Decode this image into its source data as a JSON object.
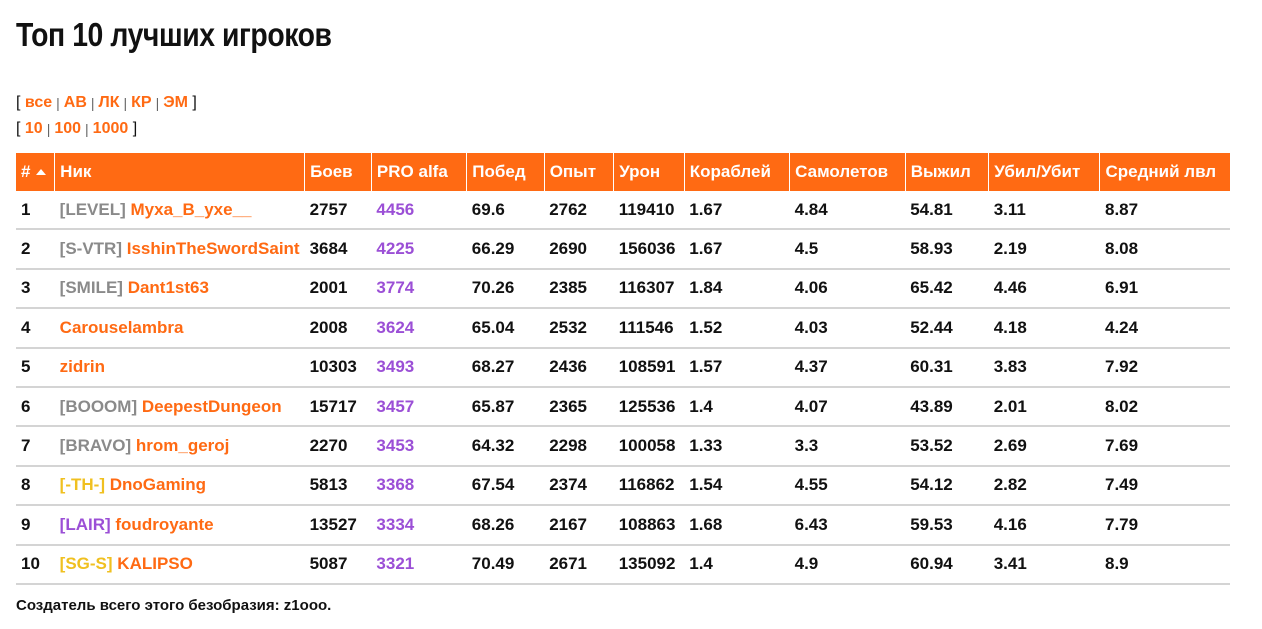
{
  "page": {
    "title": "Топ 10 лучших игроков",
    "footer": "Создатель всего этого безобразия: z1ooo."
  },
  "filters": {
    "types": [
      "все",
      "АВ",
      "ЛК",
      "КР",
      "ЭМ"
    ],
    "counts": [
      "10",
      "100",
      "1000"
    ]
  },
  "table": {
    "headers": [
      "#",
      "Ник",
      "Боев",
      "PRO alfa",
      "Побед",
      "Опыт",
      "Урон",
      "Кораблей",
      "Самолетов",
      "Выжил",
      "Убил/Убит",
      "Средний лвл"
    ],
    "rows": [
      {
        "rank": "1",
        "clan": "[LEVEL]",
        "clan_color": "gray",
        "nick": "Myxa_B_yxe__",
        "battles": "2757",
        "pro": "4456",
        "wins": "69.6",
        "exp": "2762",
        "damage": "119410",
        "ships": "1.67",
        "planes": "4.84",
        "survived": "54.81",
        "kd": "3.11",
        "avg_lvl": "8.87"
      },
      {
        "rank": "2",
        "clan": "[S-VTR]",
        "clan_color": "gray",
        "nick": "IsshinTheSwordSaint",
        "battles": "3684",
        "pro": "4225",
        "wins": "66.29",
        "exp": "2690",
        "damage": "156036",
        "ships": "1.67",
        "planes": "4.5",
        "survived": "58.93",
        "kd": "2.19",
        "avg_lvl": "8.08"
      },
      {
        "rank": "3",
        "clan": "[SMILE]",
        "clan_color": "gray",
        "nick": "Dant1st63",
        "battles": "2001",
        "pro": "3774",
        "wins": "70.26",
        "exp": "2385",
        "damage": "116307",
        "ships": "1.84",
        "planes": "4.06",
        "survived": "65.42",
        "kd": "4.46",
        "avg_lvl": "6.91"
      },
      {
        "rank": "4",
        "clan": "",
        "clan_color": "gray",
        "nick": "Carouselambra",
        "battles": "2008",
        "pro": "3624",
        "wins": "65.04",
        "exp": "2532",
        "damage": "111546",
        "ships": "1.52",
        "planes": "4.03",
        "survived": "52.44",
        "kd": "4.18",
        "avg_lvl": "4.24"
      },
      {
        "rank": "5",
        "clan": "",
        "clan_color": "gray",
        "nick": "zidrin",
        "battles": "10303",
        "pro": "3493",
        "wins": "68.27",
        "exp": "2436",
        "damage": "108591",
        "ships": "1.57",
        "planes": "4.37",
        "survived": "60.31",
        "kd": "3.83",
        "avg_lvl": "7.92"
      },
      {
        "rank": "6",
        "clan": "[BOOOM]",
        "clan_color": "gray",
        "nick": "DeepestDungeon",
        "battles": "15717",
        "pro": "3457",
        "wins": "65.87",
        "exp": "2365",
        "damage": "125536",
        "ships": "1.4",
        "planes": "4.07",
        "survived": "43.89",
        "kd": "2.01",
        "avg_lvl": "8.02"
      },
      {
        "rank": "7",
        "clan": "[BRAVO]",
        "clan_color": "gray",
        "nick": "hrom_geroj",
        "battles": "2270",
        "pro": "3453",
        "wins": "64.32",
        "exp": "2298",
        "damage": "100058",
        "ships": "1.33",
        "planes": "3.3",
        "survived": "53.52",
        "kd": "2.69",
        "avg_lvl": "7.69"
      },
      {
        "rank": "8",
        "clan": "[-TH-]",
        "clan_color": "yellow",
        "nick": "DnoGaming",
        "battles": "5813",
        "pro": "3368",
        "wins": "67.54",
        "exp": "2374",
        "damage": "116862",
        "ships": "1.54",
        "planes": "4.55",
        "survived": "54.12",
        "kd": "2.82",
        "avg_lvl": "7.49"
      },
      {
        "rank": "9",
        "clan": "[LAIR]",
        "clan_color": "purple",
        "nick": "foudroyante",
        "battles": "13527",
        "pro": "3334",
        "wins": "68.26",
        "exp": "2167",
        "damage": "108863",
        "ships": "1.68",
        "planes": "6.43",
        "survived": "59.53",
        "kd": "4.16",
        "avg_lvl": "7.79"
      },
      {
        "rank": "10",
        "clan": "[SG-S]",
        "clan_color": "yellow",
        "nick": "KALIPSO",
        "battles": "5087",
        "pro": "3321",
        "wins": "70.49",
        "exp": "2671",
        "damage": "135092",
        "ships": "1.4",
        "planes": "4.9",
        "survived": "60.94",
        "kd": "3.41",
        "avg_lvl": "8.9"
      }
    ]
  },
  "colors": {
    "accent": "#ff6a13",
    "pro_value": "#9b4fd6",
    "clan_gray": "#8a8a8a",
    "clan_yellow": "#f0c020",
    "clan_purple": "#9b4fd6",
    "row_divider": "#d4d4d4"
  },
  "icons": {
    "sort": "sort-ascending-icon"
  }
}
